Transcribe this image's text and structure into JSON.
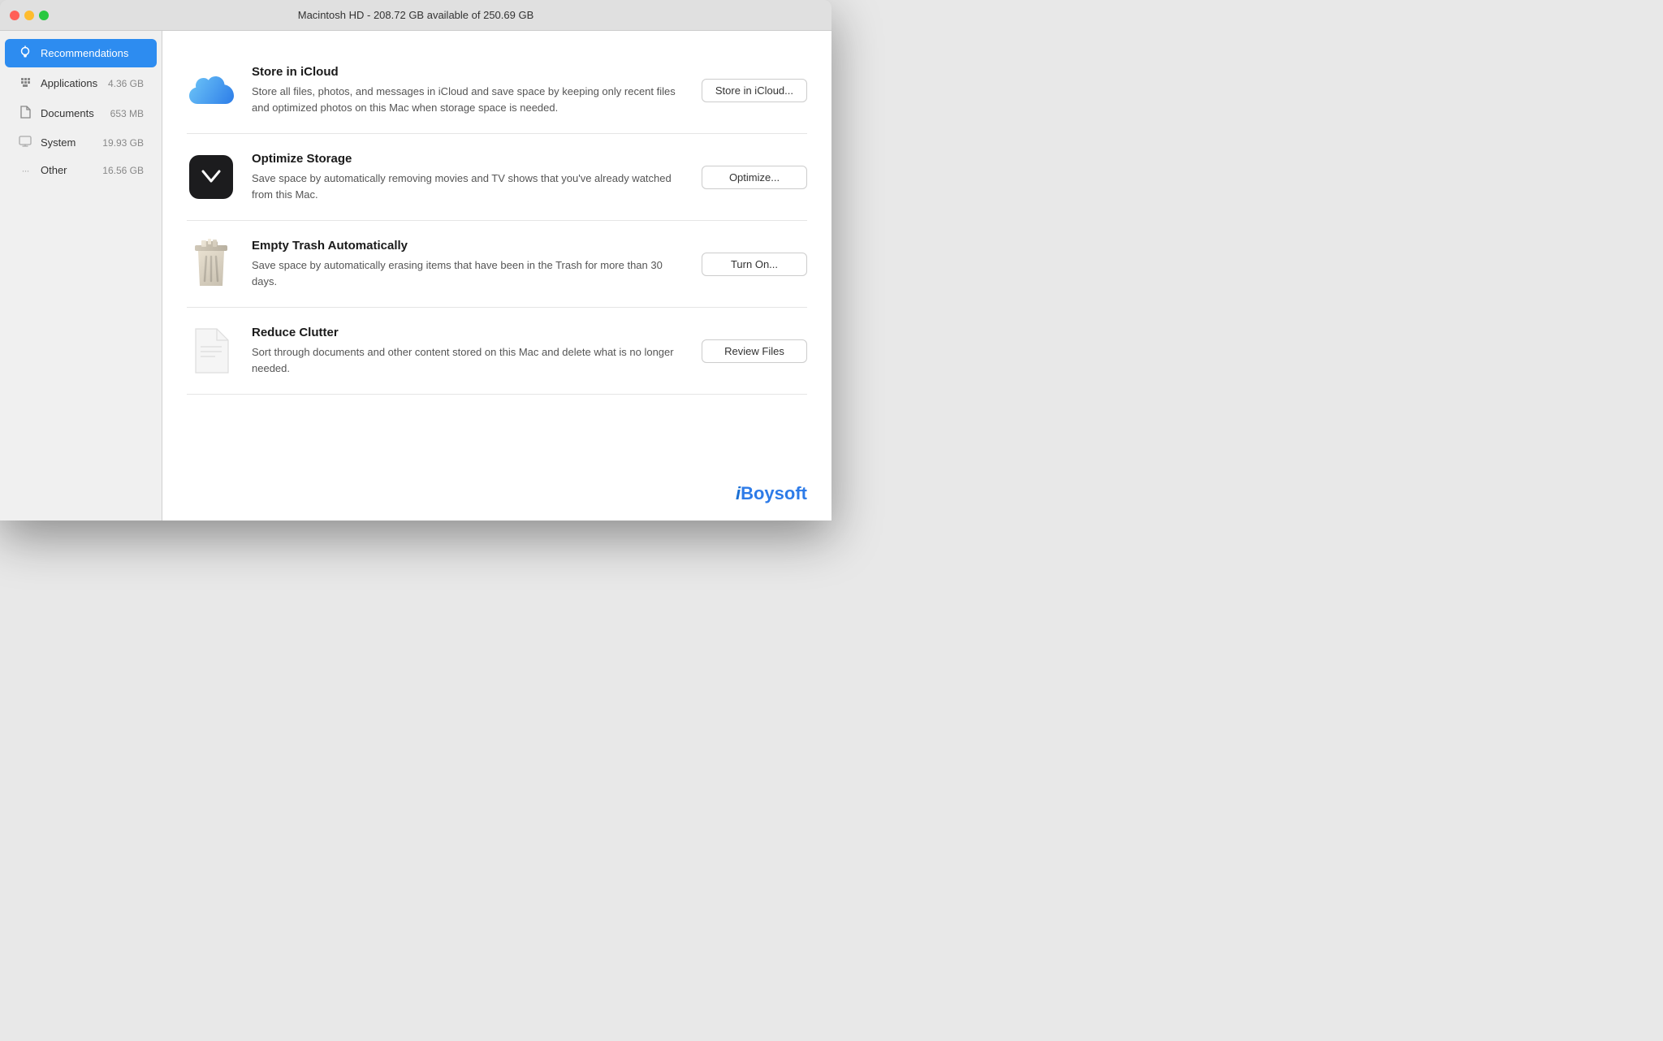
{
  "window": {
    "title": "Macintosh HD - 208.72 GB available of 250.69 GB"
  },
  "sidebar": {
    "items": [
      {
        "id": "recommendations",
        "label": "Recommendations",
        "size": "",
        "active": true,
        "icon": "lightbulb"
      },
      {
        "id": "applications",
        "label": "Applications",
        "size": "4.36 GB",
        "active": false,
        "icon": "applications"
      },
      {
        "id": "documents",
        "label": "Documents",
        "size": "653 MB",
        "active": false,
        "icon": "document"
      },
      {
        "id": "system",
        "label": "System",
        "size": "19.93 GB",
        "active": false,
        "icon": "computer"
      },
      {
        "id": "other",
        "label": "Other",
        "size": "16.56 GB",
        "active": false,
        "icon": "dots"
      }
    ]
  },
  "recommendations": [
    {
      "id": "icloud",
      "title": "Store in iCloud",
      "description": "Store all files, photos, and messages in iCloud and save space by keeping only recent files and optimized photos on this Mac when storage space is needed.",
      "button_label": "Store in iCloud...",
      "icon_type": "icloud"
    },
    {
      "id": "optimize",
      "title": "Optimize Storage",
      "description": "Save space by automatically removing movies and TV shows that you've already watched from this Mac.",
      "button_label": "Optimize...",
      "icon_type": "appletv"
    },
    {
      "id": "trash",
      "title": "Empty Trash Automatically",
      "description": "Save space by automatically erasing items that have been in the Trash for more than 30 days.",
      "button_label": "Turn On...",
      "icon_type": "trash"
    },
    {
      "id": "clutter",
      "title": "Reduce Clutter",
      "description": "Sort through documents and other content stored on this Mac and delete what is no longer needed.",
      "button_label": "Review Files",
      "icon_type": "paper"
    }
  ],
  "watermark": {
    "text": "iBoysoft",
    "i_part": "i",
    "rest_part": "Boysoft"
  }
}
